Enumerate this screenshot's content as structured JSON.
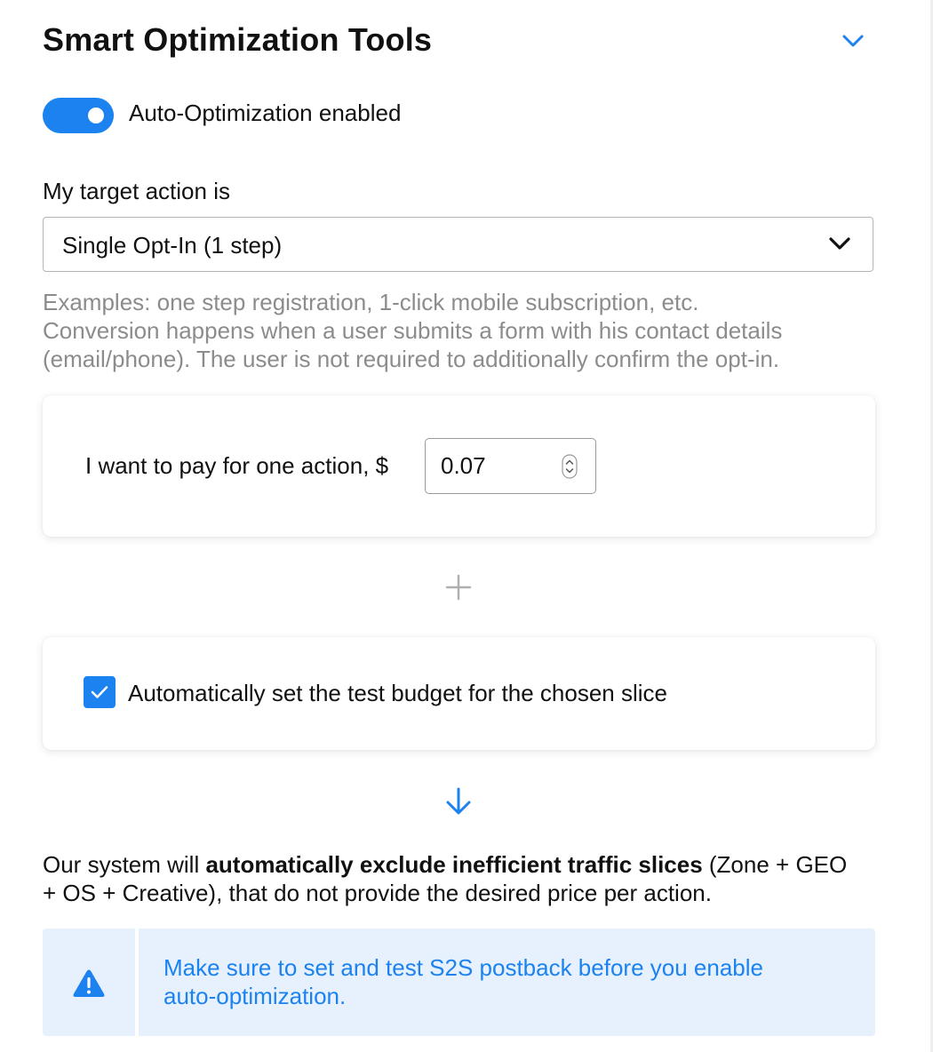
{
  "section": {
    "title": "Smart Optimization Tools",
    "collapse_icon": "chevron-down-icon"
  },
  "auto_optimization": {
    "enabled": true,
    "label": "Auto-Optimization enabled"
  },
  "target_action": {
    "label": "My target action is",
    "selected": "Single Opt-In (1 step)",
    "hint_lines": [
      "Examples: one step registration, 1-click mobile subscription, etc.",
      "Conversion happens when a user submits a form with his contact details",
      "(email/phone). The user is not required to additionally confirm the opt-in."
    ]
  },
  "price": {
    "label": "I want to pay for one action, $",
    "value": "0.07"
  },
  "budget": {
    "checked": true,
    "label": "Automatically set the test budget for the chosen slice"
  },
  "description": {
    "line1_pre": "Our system will ",
    "line1_bold": "automatically exclude inefficient traffic slices",
    "line1_post": " (Zone + GEO",
    "line2": "+ OS + Creative), that do not provide the desired price per action."
  },
  "alert": {
    "icon": "warning-icon",
    "lines": [
      "Make sure to set and test S2S postback before you enable",
      "auto-optimization."
    ]
  },
  "colors": {
    "accent": "#1b82f0",
    "hint_text": "#8c8c8c",
    "alert_background": "#e7f1fd"
  }
}
